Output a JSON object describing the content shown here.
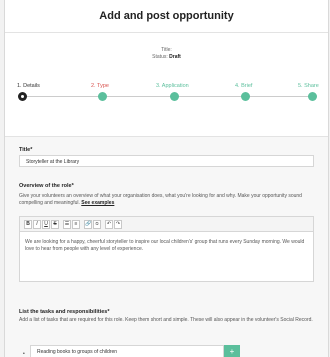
{
  "page": {
    "title": "Add and post opportunity",
    "meta_title_label": "Title:",
    "status_label": "Status:",
    "status_value": "Draft"
  },
  "steps": [
    {
      "label": "1. Details",
      "state": "active",
      "color": "#333333"
    },
    {
      "label": "2. Type",
      "state": "done",
      "color": "#d9534f"
    },
    {
      "label": "3. Application",
      "state": "done",
      "color": "#5bbf9c"
    },
    {
      "label": "4. Brief",
      "state": "done",
      "color": "#5bbf9c"
    },
    {
      "label": "5. Share",
      "state": "done",
      "color": "#5bbf9c"
    }
  ],
  "form": {
    "title_label": "Title*",
    "title_value": "Storyteller at the Library",
    "overview_label": "Overview of the role*",
    "overview_helper": "Give your volunteers an overview of what your organisation does, what you're looking for and why. Make your opportunity sound compelling and meaningful.",
    "overview_link": "See examples",
    "toolbar_icons": [
      "B",
      "I",
      "U",
      "S",
      "☰",
      "≡",
      "🔗",
      "⦸",
      "↶",
      "↷"
    ],
    "editor_text": "We are looking for a happy, cheerful storyteller to inspire our local children's' group that runs every Sunday morning. We would love to hear from people with any level of experience.",
    "tasks_label": "List the tasks and responsibilities*",
    "tasks_helper": "Add a list of tasks that are required for this role. Keep them short and simple. These will also appear in the volunteer's Social Record.",
    "task_item": "Reading books to groups of children",
    "add_label": "+"
  },
  "colors": {
    "accent": "#5bbf9c",
    "warning": "#d9534f"
  }
}
